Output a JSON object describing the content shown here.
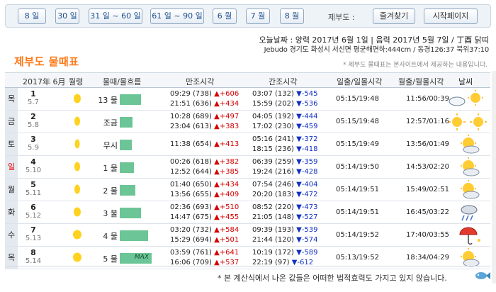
{
  "nav": {
    "buttons": [
      "8 일",
      "30 일",
      "31 일 ~ 60 일",
      "61 일 ~ 90 일",
      "6 월",
      "7 월",
      "8 월"
    ],
    "site_label": "제부도 :",
    "favorites": "즐겨찾기",
    "homepage": "시작페이지"
  },
  "info": {
    "line1": "오늘날짜 : 양력 2017년 6월 1일 | 음력 2017년 5월 7일 / 丁酉 닭띠",
    "line2": "Jebudo 경기도 화성시 서신면 평균해면하:444cm / 동경126:37 북위37:10"
  },
  "title": "제부도 물때표",
  "notice": "* 제부도 물때표는 본사이트에서 제공하는 내용입니다.",
  "header": {
    "month": "2017年 6月",
    "moon": "월령",
    "tide_flow": "물때/물흐름",
    "high": "만조시각",
    "low": "간조시각",
    "sun": "일출/일몰시각",
    "moonrise": "월출/월몰시각",
    "weather": "날씨"
  },
  "rows": [
    {
      "wd": "목",
      "day": "1",
      "lunar": "5.7",
      "mul": "13 물",
      "level": 0.3,
      "max": "",
      "hi1": "09:29 (738)",
      "hi1d": "▲+606",
      "hi2": "21:51 (636)",
      "hi2d": "▲+434",
      "lo1": "03:07 (132)",
      "lo1d": "▼-545",
      "lo2": "15:59 (202)",
      "lo2d": "▼-536",
      "sun": "05:15/19:48",
      "moonrs": "11:56/00:39",
      "weather": "cloud-sun"
    },
    {
      "wd": "금",
      "day": "2",
      "lunar": "5.8",
      "mul": "조금",
      "level": 0.18,
      "max": "",
      "hi1": "10:28 (689)",
      "hi1d": "▲+497",
      "hi2": "23:04 (613)",
      "hi2d": "▲+383",
      "lo1": "04:05 (192)",
      "lo1d": "▼-444",
      "lo2": "17:02 (230)",
      "lo2d": "▼-459",
      "sun": "05:15/19:48",
      "moonrs": "12:57/01:16",
      "weather": "sun-sun"
    },
    {
      "wd": "토",
      "day": "3",
      "lunar": "5.9",
      "mul": "무시",
      "level": 0.17,
      "max": "",
      "hi1": "11:38 (654)",
      "hi1d": "▲+413",
      "hi2": "",
      "hi2d": "",
      "lo1": "05:16 (241)",
      "lo1d": "▼-372",
      "lo2": "18:15 (236)",
      "lo2d": "▼-418",
      "sun": "05:15/19:49",
      "moonrs": "13:56/01:49",
      "weather": "sun-cloud"
    },
    {
      "wd": "일",
      "day": "4",
      "lunar": "5.10",
      "mul": "1 물",
      "level": 0.2,
      "max": "",
      "hi1": "00:26 (618)",
      "hi1d": "▲+382",
      "hi2": "12:52 (644)",
      "hi2d": "▲+385",
      "lo1": "06:39 (259)",
      "lo1d": "▼-359",
      "lo2": "19:24 (216)",
      "lo2d": "▼-428",
      "sun": "05:14/19:50",
      "moonrs": "14:53/02:20",
      "weather": "sun-cloud"
    },
    {
      "wd": "월",
      "day": "5",
      "lunar": "5.11",
      "mul": "2 물",
      "level": 0.22,
      "max": "",
      "hi1": "01:40 (650)",
      "hi1d": "▲+434",
      "hi2": "13:56 (655)",
      "hi2d": "▲+409",
      "lo1": "07:54 (246)",
      "lo1d": "▼-404",
      "lo2": "20:20 (183)",
      "lo2d": "▼-472",
      "sun": "05:14/19:51",
      "moonrs": "15:49/02:51",
      "weather": "sun-cloud"
    },
    {
      "wd": "화",
      "day": "6",
      "lunar": "5.12",
      "mul": "3 물",
      "level": 0.3,
      "max": "",
      "hi1": "02:36 (693)",
      "hi1d": "▲+510",
      "hi2": "14:47 (675)",
      "hi2d": "▲+455",
      "lo1": "08:52 (220)",
      "lo1d": "▼-473",
      "lo2": "21:05 (148)",
      "lo2d": "▼-527",
      "sun": "05:14/19:51",
      "moonrs": "16:45/03:22",
      "weather": "rain"
    },
    {
      "wd": "수",
      "day": "7",
      "lunar": "5.13",
      "mul": "4 물",
      "level": 0.4,
      "max": "",
      "hi1": "03:20 (732)",
      "hi1d": "▲+584",
      "hi2": "15:29 (694)",
      "hi2d": "▲+501",
      "lo1": "09:39 (193)",
      "lo1d": "▼-539",
      "lo2": "21:44 (120)",
      "lo2d": "▼-574",
      "sun": "05:14/19:52",
      "moonrs": "17:40/03:55",
      "weather": "umbrella"
    },
    {
      "wd": "목",
      "day": "8",
      "lunar": "5.14",
      "mul": "5 물",
      "level": 0.45,
      "max": "MAX",
      "hi1": "03:59 (761)",
      "hi1d": "▲+641",
      "hi2": "16:06 (709)",
      "hi2d": "▲+537",
      "lo1": "10:19 (172)",
      "lo1d": "▼-589",
      "lo2": "22:19 (97)",
      "lo2d": "▼-612",
      "sun": "05:13/19:52",
      "moonrs": "18:34/04:29",
      "weather": "sun-cloud"
    }
  ],
  "footer": "* 본 계산식에서 나온 값들은 어떠한 법적효력도 가지고 있지 않습니다."
}
